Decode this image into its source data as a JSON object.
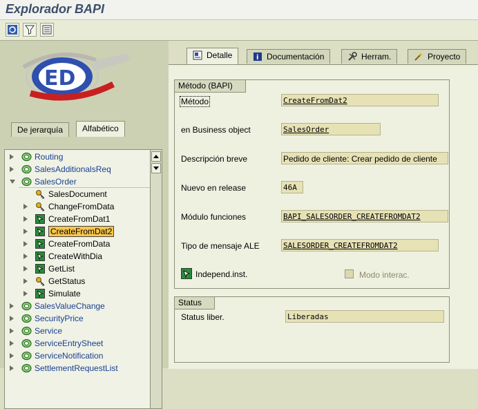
{
  "window": {
    "title": "Explorador BAPI"
  },
  "left": {
    "tabs": [
      "De jerarquía",
      "Alfabético"
    ],
    "tree": [
      {
        "label": "Routing",
        "level": 0,
        "expander": "right",
        "icon": "green-circle"
      },
      {
        "label": "SalesAdditionalsReq",
        "level": 0,
        "expander": "right",
        "icon": "green-circle"
      },
      {
        "label": "SalesOrder",
        "level": 0,
        "expander": "down",
        "icon": "green-circle"
      },
      {
        "label": "SalesDocument",
        "level": 1,
        "expander": "",
        "icon": "key"
      },
      {
        "label": "ChangeFromData",
        "level": 1,
        "expander": "right",
        "icon": "key"
      },
      {
        "label": "CreateFromDat1",
        "level": 1,
        "expander": "right",
        "icon": "method"
      },
      {
        "label": "CreateFromDat2",
        "level": 1,
        "expander": "right",
        "icon": "method",
        "selected": true
      },
      {
        "label": "CreateFromData",
        "level": 1,
        "expander": "right",
        "icon": "method"
      },
      {
        "label": "CreateWithDia",
        "level": 1,
        "expander": "right",
        "icon": "method"
      },
      {
        "label": "GetList",
        "level": 1,
        "expander": "right",
        "icon": "method"
      },
      {
        "label": "GetStatus",
        "level": 1,
        "expander": "right",
        "icon": "key"
      },
      {
        "label": "Simulate",
        "level": 1,
        "expander": "right",
        "icon": "method"
      },
      {
        "label": "SalesValueChange",
        "level": 0,
        "expander": "right",
        "icon": "green-circle"
      },
      {
        "label": "SecurityPrice",
        "level": 0,
        "expander": "right",
        "icon": "green-circle"
      },
      {
        "label": "Service",
        "level": 0,
        "expander": "right",
        "icon": "green-circle"
      },
      {
        "label": "ServiceEntrySheet",
        "level": 0,
        "expander": "right",
        "icon": "green-circle"
      },
      {
        "label": "ServiceNotification",
        "level": 0,
        "expander": "right",
        "icon": "green-circle"
      },
      {
        "label": "SettlementRequestList",
        "level": 0,
        "expander": "right",
        "icon": "green-circle"
      }
    ]
  },
  "tabs": [
    "Detalle",
    "Documentación",
    "Herram.",
    "Proyecto"
  ],
  "method_group": {
    "title": "Método (BAPI)",
    "fields": {
      "metodo": {
        "label": "Método",
        "value": "CreateFromDat2"
      },
      "business_object": {
        "label": "en Business object",
        "value": "SalesOrder"
      },
      "descripcion": {
        "label": "Descripción breve",
        "value": "Pedido de cliente: Crear pedido de cliente"
      },
      "release": {
        "label": "Nuevo en release",
        "value": "46A"
      },
      "modulo": {
        "label": "Módulo funciones",
        "value": "BAPI_SALESORDER_CREATEFROMDAT2"
      },
      "mensaje": {
        "label": "Tipo de mensaje ALE",
        "value": "SALESORDER_CREATEFROMDAT2"
      }
    },
    "independ_label": "Independ.inst.",
    "modo_label": "Modo interac."
  },
  "status_group": {
    "title": "Status",
    "label": "Status liber.",
    "value": "Liberadas"
  },
  "colors": {
    "selected": "#f7c64b",
    "link": "#1a3f8f",
    "field": "#e6e2b6"
  }
}
